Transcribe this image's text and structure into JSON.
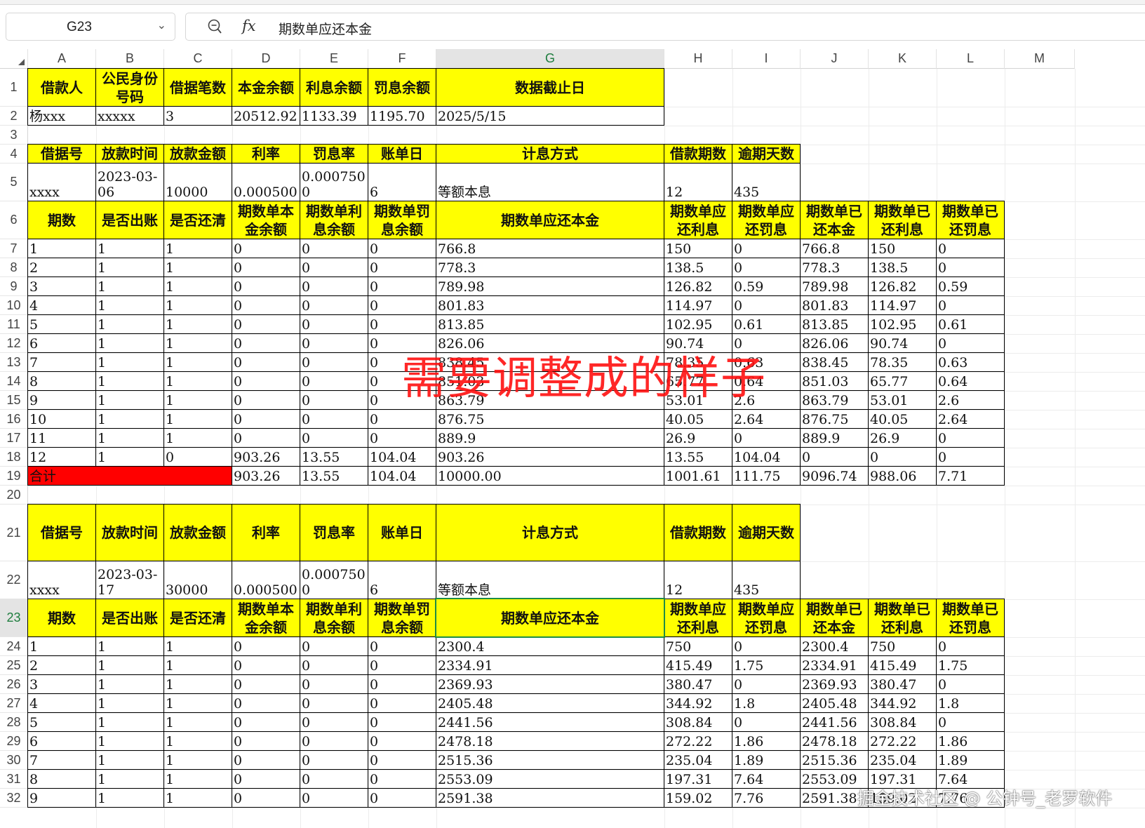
{
  "namebox": {
    "ref": "G23"
  },
  "formula": {
    "content": "期数单应还本金"
  },
  "columns": [
    "A",
    "B",
    "C",
    "D",
    "E",
    "F",
    "G",
    "H",
    "I",
    "J",
    "K",
    "L",
    "M"
  ],
  "selected": {
    "col": "G",
    "row": "23"
  },
  "rows": [
    "1",
    "2",
    "3",
    "4",
    "5",
    "6",
    "7",
    "8",
    "9",
    "10",
    "11",
    "12",
    "13",
    "14",
    "15",
    "16",
    "17",
    "18",
    "19",
    "20",
    "21",
    "22",
    "23",
    "24",
    "25",
    "26",
    "27",
    "28",
    "29",
    "30",
    "31",
    "32"
  ],
  "summary": {
    "headers": [
      "借款人",
      "公民身份号码",
      "借据笔数",
      "本金余额",
      "利息余额",
      "罚息余额",
      "数据截止日"
    ],
    "values": [
      "杨xxx",
      "xxxxx",
      "3",
      "20512.92",
      "1133.39",
      "1195.70",
      "2025/5/15"
    ]
  },
  "loan_info_headers": [
    "借据号",
    "放款时间",
    "放款金额",
    "利率",
    "罚息率",
    "账单日",
    "计息方式",
    "借款期数",
    "逾期天数"
  ],
  "schedule_headers": [
    "期数",
    "是否出账",
    "是否还清",
    "期数单本金余额",
    "期数单利息余额",
    "期数单罚息余额",
    "期数单应还本金",
    "期数单应还利息",
    "期数单应还罚息",
    "期数单已还本金",
    "期数单已还利息",
    "期数单已还罚息"
  ],
  "loan1": {
    "info": [
      "xxxx",
      "2023-03-06",
      "10000",
      "0.000500",
      "0.000750 0",
      "6",
      "等额本息",
      "12",
      "435"
    ],
    "rows": [
      [
        "1",
        "1",
        "1",
        "0",
        "0",
        "0",
        "766.8",
        "150",
        "0",
        "766.8",
        "150",
        "0"
      ],
      [
        "2",
        "1",
        "1",
        "0",
        "0",
        "0",
        "778.3",
        "138.5",
        "0",
        "778.3",
        "138.5",
        "0"
      ],
      [
        "3",
        "1",
        "1",
        "0",
        "0",
        "0",
        "789.98",
        "126.82",
        "0.59",
        "789.98",
        "126.82",
        "0.59"
      ],
      [
        "4",
        "1",
        "1",
        "0",
        "0",
        "0",
        "801.83",
        "114.97",
        "0",
        "801.83",
        "114.97",
        "0"
      ],
      [
        "5",
        "1",
        "1",
        "0",
        "0",
        "0",
        "813.85",
        "102.95",
        "0.61",
        "813.85",
        "102.95",
        "0.61"
      ],
      [
        "6",
        "1",
        "1",
        "0",
        "0",
        "0",
        "826.06",
        "90.74",
        "0",
        "826.06",
        "90.74",
        "0"
      ],
      [
        "7",
        "1",
        "1",
        "0",
        "0",
        "0",
        "838.45",
        "78.35",
        "0.63",
        "838.45",
        "78.35",
        "0.63"
      ],
      [
        "8",
        "1",
        "1",
        "0",
        "0",
        "0",
        "851.03",
        "65.77",
        "0.64",
        "851.03",
        "65.77",
        "0.64"
      ],
      [
        "9",
        "1",
        "1",
        "0",
        "0",
        "0",
        "863.79",
        "53.01",
        "2.6",
        "863.79",
        "53.01",
        "2.6"
      ],
      [
        "10",
        "1",
        "1",
        "0",
        "0",
        "0",
        "876.75",
        "40.05",
        "2.64",
        "876.75",
        "40.05",
        "2.64"
      ],
      [
        "11",
        "1",
        "1",
        "0",
        "0",
        "0",
        "889.9",
        "26.9",
        "0",
        "889.9",
        "26.9",
        "0"
      ],
      [
        "12",
        "1",
        "0",
        "903.26",
        "13.55",
        "104.04",
        "903.26",
        "13.55",
        "104.04",
        "0",
        "0",
        "0"
      ]
    ],
    "total": [
      "合计",
      "903.26",
      "13.55",
      "104.04",
      "10000.00",
      "1001.61",
      "111.75",
      "9096.74",
      "988.06",
      "7.71"
    ]
  },
  "loan2": {
    "info": [
      "xxxx",
      "2023-03-17",
      "30000",
      "0.000500",
      "0.000750 0",
      "6",
      "等额本息",
      "12",
      "435"
    ],
    "rows": [
      [
        "1",
        "1",
        "1",
        "0",
        "0",
        "0",
        "2300.4",
        "750",
        "0",
        "2300.4",
        "750",
        "0"
      ],
      [
        "2",
        "1",
        "1",
        "0",
        "0",
        "0",
        "2334.91",
        "415.49",
        "1.75",
        "2334.91",
        "415.49",
        "1.75"
      ],
      [
        "3",
        "1",
        "1",
        "0",
        "0",
        "0",
        "2369.93",
        "380.47",
        "0",
        "2369.93",
        "380.47",
        "0"
      ],
      [
        "4",
        "1",
        "1",
        "0",
        "0",
        "0",
        "2405.48",
        "344.92",
        "1.8",
        "2405.48",
        "344.92",
        "1.8"
      ],
      [
        "5",
        "1",
        "1",
        "0",
        "0",
        "0",
        "2441.56",
        "308.84",
        "0",
        "2441.56",
        "308.84",
        "0"
      ],
      [
        "6",
        "1",
        "1",
        "0",
        "0",
        "0",
        "2478.18",
        "272.22",
        "1.86",
        "2478.18",
        "272.22",
        "1.86"
      ],
      [
        "7",
        "1",
        "1",
        "0",
        "0",
        "0",
        "2515.36",
        "235.04",
        "1.89",
        "2515.36",
        "235.04",
        "1.89"
      ],
      [
        "8",
        "1",
        "1",
        "0",
        "0",
        "0",
        "2553.09",
        "197.31",
        "7.64",
        "2553.09",
        "197.31",
        "7.64"
      ],
      [
        "9",
        "1",
        "1",
        "0",
        "0",
        "0",
        "2591.38",
        "159.02",
        "7.76",
        "2591.38",
        "159.02",
        "7.76"
      ]
    ]
  },
  "overlay_text": "需要调整成的样子",
  "watermark": "掘金技术社区 @ 公钟号_老罗软件",
  "colors": {
    "header_fill": "#ffff00",
    "total_fill": "#ff0000",
    "selection": "#1e8c45",
    "annotation": "#ff1010"
  }
}
